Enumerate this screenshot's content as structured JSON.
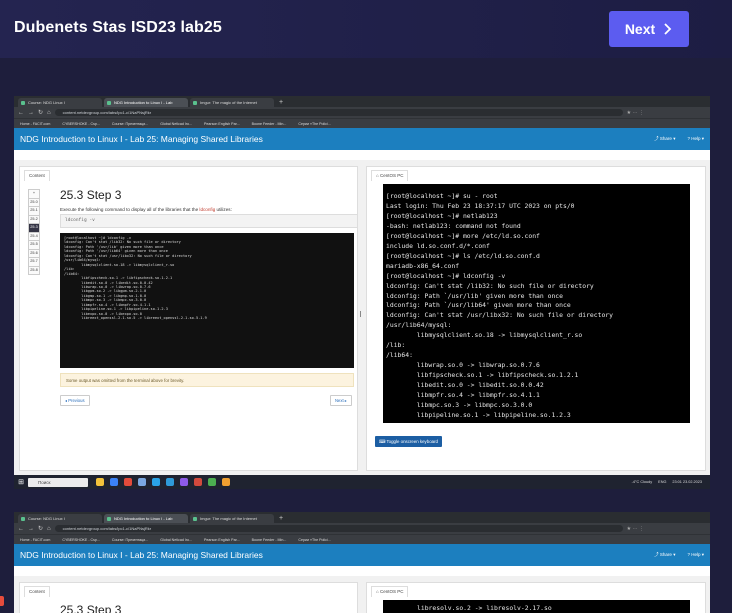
{
  "header": {
    "title": "Dubenets Stas ISD23 lab25",
    "next_label": "Next"
  },
  "browser": {
    "tabs": [
      "Course: NDG Linux I",
      "NDG Introduction to Linux I - Lab",
      "Imgur: The magic of the Internet"
    ],
    "url": "content.netdevgroup.com/labs/lpc1-c/1NaPNsjRkr",
    "bookmarks": [
      "Home - FACIT.com",
      "CYBERSHOKE - Csp...",
      "Course: Презентаци...",
      "Global Netlcad Iro...",
      "Pearson English Par...",
      "Boone Feeder - Min...",
      "Серии «The Polici..."
    ]
  },
  "lab": {
    "title": "NDG Introduction to Linux I - Lab 25: Managing Shared Libraries",
    "share": "Share",
    "help": "Help"
  },
  "left_panel": {
    "tab": "Content",
    "steps": [
      "+",
      "25.0",
      "25.1",
      "25.2",
      "25.3",
      "25.4",
      "25.5",
      "25.6",
      "25.7",
      "25.8"
    ],
    "step_title": "25.3 Step 3",
    "instruction_pre": "Execute the following command to display all of the libraries that the ",
    "instruction_cmd": "ldconfig",
    "instruction_post": " utilizes:",
    "command": "ldconfig -v",
    "terminal_lines": "[root@localhost ~]# ldconfig -v\nldconfig: Can't stat /lib32: No such file or directory\nldconfig: Path '/usr/lib' given more than once\nldconfig: Path '/usr/lib64' given more than once\nldconfig: Can't stat /usr/libx32: No such file or directory\n/usr/lib64/mysql:\n        libmysqlclient.so.18 -> libmysqlclient_r.so\n/lib:\n/lib64:\n        libfipscheck.so.1 -> libfipscheck.so.1.2.1\n        libedit.so.0 -> libedit.so.0.0.42\n        libwrap.so.0 -> libwrap.so.0.7.6\n        libgpm.so.2 -> libgpm.so.2.1.0\n        libgmp.so.1 -> libgmp.so.1.0.0\n        libmpc.so.3 -> libmpc.so.3.0.0\n        libmpfr.so.4 -> libmpfr.so.4.1.1\n        libpipeline.so.1 -> libpipeline.so.1.2.3\n        libexpo.so.0 -> libexpo.so.0\n        libreext_openssl-2.1.so.5 -> libreext_openssl-2.1.so.5.1.9",
    "note": "Some output was omitted from the terminal above for brevity.",
    "prev_label": "◂ Previous",
    "next_label": "Next ▸"
  },
  "right_panel": {
    "tab": "CentOS PC",
    "terminal_lines": "[root@localhost ~]# su - root\nLast login: Thu Feb 23 18:37:17 UTC 2023 on pts/0\n[root@localhost ~]# netlab123\n-bash: netlab123: command not found\n[root@localhost ~]# more /etc/ld.so.conf\ninclude ld.so.conf.d/*.conf\n[root@localhost ~]# ls /etc/ld.so.conf.d\nmariadb-x86_64.conf\n[root@localhost ~]# ldconfig -v\nldconfig: Can't stat /lib32: No such file or directory\nldconfig: Path `/usr/lib' given more than once\nldconfig: Path `/usr/lib64' given more than once\nldconfig: Can't stat /usr/libx32: No such file or directory\n/usr/lib64/mysql:\n        libmysqlclient.so.18 -> libmysqlclient_r.so\n/lib:\n/lib64:\n        libwrap.so.0 -> libwrap.so.0.7.6\n        libfipscheck.so.1 -> libfipscheck.so.1.2.1\n        libedit.so.0 -> libedit.so.0.0.42\n        libmpfr.so.4 -> libmpfr.so.4.1.1\n        libmpc.so.3 -> libmpc.so.3.0.0\n        libpipeline.so.1 -> libpipeline.so.1.2.3",
    "keyboard_label": "Toggle onscreen keyboard"
  },
  "taskbar": {
    "search": "Поиск",
    "weather": "-4°C Cloudy",
    "lang": "ENG",
    "time": "23:01",
    "date": "23.02.2023"
  },
  "second_shot": {
    "step_title": "25.3 Step 3",
    "tab": "CentOS PC",
    "terminal_line": "libresolv.so.2 -> libresolv-2.17.so"
  },
  "colors": {
    "accent": "#5c5cf0",
    "lab_header": "#1c7fbf",
    "page_bg": "#1e1e3c"
  }
}
